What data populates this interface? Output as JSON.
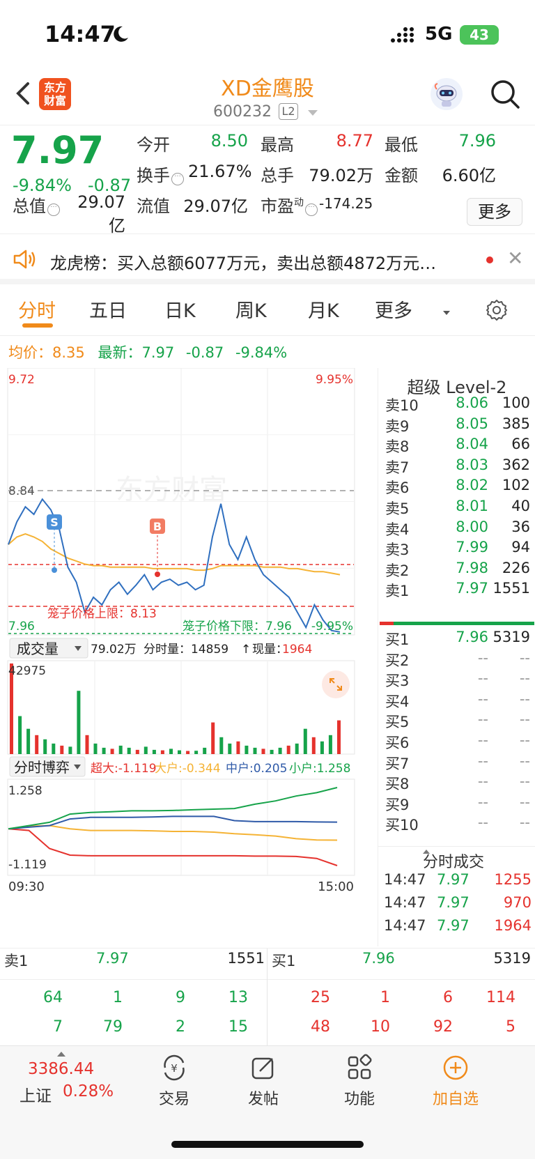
{
  "status_bar": {
    "time": "14:47",
    "network": "5G",
    "battery": "43"
  },
  "header": {
    "logo_text_1": "东方",
    "logo_text_2": "财富",
    "stock_name": "XD金鹰股",
    "stock_code": "600232",
    "level_badge": "L2"
  },
  "quote": {
    "price": "7.97",
    "change_pct": "-9.84%",
    "change": "-0.87",
    "open_label": "今开",
    "open": "8.50",
    "high_label": "最高",
    "high": "8.77",
    "low_label": "最低",
    "low": "7.96",
    "turnover_label": "换手",
    "turnover": "21.67%",
    "volume_label": "总手",
    "volume": "79.02万",
    "amount_label": "金额",
    "amount": "6.60亿",
    "mktcap_label": "总值",
    "mktcap": "29.07亿",
    "float_label": "流值",
    "float_cap": "29.07亿",
    "pe_label": "市盈",
    "pe_sup": "动",
    "pe": "-174.25",
    "more_button": "更多"
  },
  "dragon_tiger": {
    "text": "龙虎榜：买入总额6077万元，卖出总额4872万元…"
  },
  "tabs": [
    "分时",
    "五日",
    "日K",
    "周K",
    "月K",
    "更多"
  ],
  "avg_line": {
    "avg_label": "均价：",
    "avg_value": "8.35",
    "latest_label": "最新：",
    "latest_value": "7.97",
    "change": "-0.87",
    "change_pct": "-9.84%"
  },
  "intraday": {
    "y_top_label": "9.72",
    "y_top_pct": "9.95%",
    "ref_label": "8.84",
    "y_bottom_label": "7.96",
    "y_bottom_pct": "-9.95%",
    "watermark": "东方财富",
    "upper_cage_label": "笼子价格上限：8.13",
    "lower_cage_label": "笼子价格下限：7.96",
    "sell_marker": "S",
    "buy_marker": "B",
    "colors": {
      "price": "#2f6fbf",
      "avg": "#f5b335",
      "cage": "#e5322d"
    }
  },
  "volume_bar": {
    "selector": "成交量",
    "total": "79.02万",
    "minute_label": "分时量：14859",
    "arrow": "↑",
    "current_label": "现量：",
    "current": "1964",
    "ymax": "42975"
  },
  "flow": {
    "selector": "分时博弈",
    "super_label": "超大:",
    "super_value": "-1.119",
    "large_label": "大户:",
    "large_value": "-0.344",
    "medium_label": "中户:",
    "medium_value": "0.205",
    "small_label": "小户:",
    "small_value": "1.258",
    "y_top": "1.258",
    "y_bottom": "-1.119",
    "x_start": "09:30",
    "x_end": "15:00"
  },
  "level2": {
    "title": "超级 Level-2",
    "asks": [
      {
        "label": "卖10",
        "price": "8.06",
        "vol": "100"
      },
      {
        "label": "卖9",
        "price": "8.05",
        "vol": "385"
      },
      {
        "label": "卖8",
        "price": "8.04",
        "vol": "66"
      },
      {
        "label": "卖7",
        "price": "8.03",
        "vol": "362"
      },
      {
        "label": "卖6",
        "price": "8.02",
        "vol": "102"
      },
      {
        "label": "卖5",
        "price": "8.01",
        "vol": "40"
      },
      {
        "label": "卖4",
        "price": "8.00",
        "vol": "36"
      },
      {
        "label": "卖3",
        "price": "7.99",
        "vol": "94"
      },
      {
        "label": "卖2",
        "price": "7.98",
        "vol": "226"
      },
      {
        "label": "卖1",
        "price": "7.97",
        "vol": "1551"
      }
    ],
    "bids": [
      {
        "label": "买1",
        "price": "7.96",
        "vol": "5319"
      },
      {
        "label": "买2",
        "price": "--",
        "vol": "--"
      },
      {
        "label": "买3",
        "price": "--",
        "vol": "--"
      },
      {
        "label": "买4",
        "price": "--",
        "vol": "--"
      },
      {
        "label": "买5",
        "price": "--",
        "vol": "--"
      },
      {
        "label": "买6",
        "price": "--",
        "vol": "--"
      },
      {
        "label": "买7",
        "price": "--",
        "vol": "--"
      },
      {
        "label": "买8",
        "price": "--",
        "vol": "--"
      },
      {
        "label": "买9",
        "price": "--",
        "vol": "--"
      },
      {
        "label": "买10",
        "price": "--",
        "vol": "--"
      }
    ],
    "ticks_title": "分时成交",
    "ticks": [
      {
        "time": "14:47",
        "price": "7.97",
        "vol": "1255"
      },
      {
        "time": "14:47",
        "price": "7.97",
        "vol": "970"
      },
      {
        "time": "14:47",
        "price": "7.97",
        "vol": "1964"
      }
    ]
  },
  "queue": {
    "sell_label": "卖1",
    "sell_price": "7.97",
    "sell_vol": "1551",
    "buy_label": "买1",
    "buy_price": "7.96",
    "buy_vol": "5319",
    "sell_orders": [
      "64",
      "1",
      "9",
      "13",
      "7",
      "79",
      "2",
      "15"
    ],
    "buy_orders": [
      "25",
      "1",
      "6",
      "114",
      "48",
      "10",
      "92",
      "5"
    ]
  },
  "bottom_nav": {
    "index_value": "3386.44",
    "index_name": "上证",
    "index_pct": "0.28%",
    "items": [
      "交易",
      "发帖",
      "功能",
      "加自选"
    ]
  },
  "chart_data": [
    {
      "type": "line",
      "title": "",
      "ylim": [
        7.96,
        9.72
      ],
      "reference": 8.84,
      "series": [
        {
          "values": [
            8.55,
            8.7,
            8.8,
            8.75,
            8.85,
            8.78,
            8.65,
            8.4,
            8.3,
            8.1,
            8.2,
            8.15,
            8.25,
            8.3,
            8.22,
            8.28,
            8.35,
            8.25,
            8.3,
            8.32,
            8.28,
            8.3,
            8.25,
            8.28,
            8.6,
            8.82,
            8.55,
            8.45,
            8.6,
            8.45,
            8.35,
            8.3,
            8.25,
            8.2,
            8.1,
            8.0,
            8.15,
            8.05,
            7.98,
            7.97
          ]
        },
        {
          "values": [
            8.55,
            8.6,
            8.62,
            8.6,
            8.57,
            8.52,
            8.49,
            8.46,
            8.44,
            8.42,
            8.41,
            8.41,
            8.4,
            8.4,
            8.4,
            8.4,
            8.4,
            8.39,
            8.39,
            8.39,
            8.39,
            8.39,
            8.38,
            8.38,
            8.39,
            8.41,
            8.41,
            8.41,
            8.41,
            8.41,
            8.4,
            8.4,
            8.4,
            8.39,
            8.39,
            8.38,
            8.37,
            8.37,
            8.36,
            8.35
          ]
        }
      ]
    },
    {
      "type": "bar",
      "title": "成交量",
      "ylim": [
        0,
        42975
      ],
      "values": [
        42975,
        18000,
        12000,
        9000,
        7000,
        5000,
        4000,
        3500,
        30000,
        9000,
        5000,
        3000,
        2500,
        4000,
        3000,
        2000,
        3500,
        2000,
        1800,
        2500,
        1800,
        1500,
        1600,
        3000,
        15000,
        8000,
        5000,
        6000,
        4000,
        3000,
        2500,
        2000,
        3000,
        4000,
        5000,
        12000,
        8000,
        6000,
        9000,
        16000
      ]
    },
    {
      "type": "line",
      "title": "分时博弈",
      "ylim": [
        -1.119,
        1.258
      ],
      "series": [
        {
          "name": "超大",
          "values": [
            0.0,
            -0.05,
            -0.6,
            -0.8,
            -0.82,
            -0.82,
            -0.82,
            -0.82,
            -0.82,
            -0.82,
            -0.82,
            -0.82,
            -0.83,
            -0.83,
            -0.84,
            -0.9,
            -1.119
          ]
        },
        {
          "name": "大户",
          "values": [
            0.0,
            0.08,
            0.1,
            0.0,
            -0.05,
            -0.05,
            -0.05,
            -0.06,
            -0.08,
            -0.08,
            -0.1,
            -0.15,
            -0.18,
            -0.22,
            -0.3,
            -0.34,
            -0.344
          ]
        },
        {
          "name": "中户",
          "values": [
            0.0,
            0.05,
            0.1,
            0.3,
            0.35,
            0.35,
            0.35,
            0.36,
            0.38,
            0.38,
            0.38,
            0.25,
            0.22,
            0.22,
            0.22,
            0.21,
            0.205
          ]
        },
        {
          "name": "小户",
          "values": [
            0.0,
            0.1,
            0.2,
            0.45,
            0.5,
            0.52,
            0.55,
            0.55,
            0.56,
            0.58,
            0.6,
            0.62,
            0.75,
            0.85,
            1.0,
            1.1,
            1.258
          ]
        }
      ]
    }
  ]
}
